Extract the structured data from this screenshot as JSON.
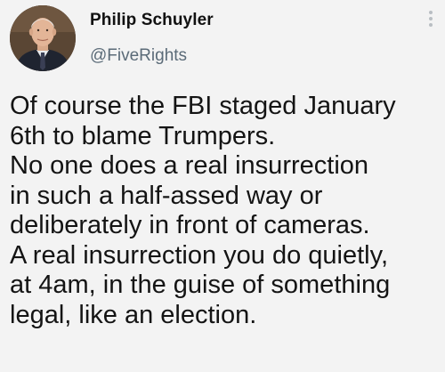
{
  "author": {
    "display_name": "Philip Schuyler",
    "handle": "@FiveRights"
  },
  "menu_icon": "more-vertical-icon",
  "tweet_lines": [
    "Of course the FBI staged January",
    "6th to blame Trumpers.",
    "No one does a real insurrection",
    "in such a half-assed way or",
    "deliberately in front of cameras.",
    "A real insurrection you do quietly,",
    "at 4am, in the guise of something",
    "legal, like an election."
  ],
  "colors": {
    "background": "#f3f3f3",
    "text": "#141414",
    "handle": "#5b6b78"
  }
}
